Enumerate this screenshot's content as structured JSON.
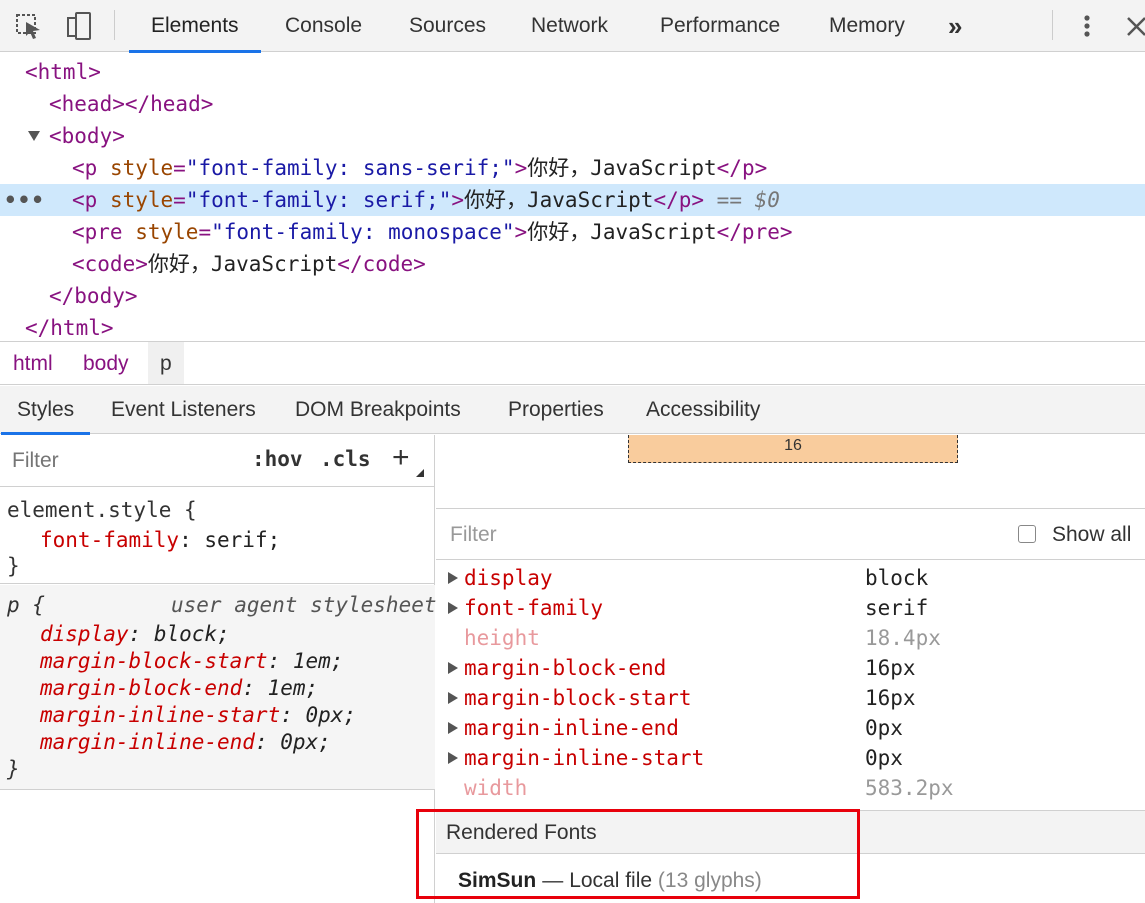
{
  "toolbar": {
    "tabs": [
      "Elements",
      "Console",
      "Sources",
      "Network",
      "Performance",
      "Memory"
    ],
    "more": "»",
    "icons": [
      "inspect-icon",
      "device-toggle-icon",
      "kebab-menu-icon",
      "close-icon"
    ]
  },
  "dom": {
    "lines": [
      {
        "tag_open": "<html>"
      },
      {
        "tag_open": "<head>",
        "tag_close": "</head>"
      },
      {
        "tag_open": "<body>"
      },
      {
        "tag_pre": "<p",
        "attr": "style",
        "value": "\"font-family: sans-serif;\"",
        "text": "你好，JavaScript",
        "tag_close": "</p>"
      },
      {
        "tag_pre": "<p",
        "attr": "style",
        "value": "\"font-family: serif;\"",
        "text": "你好，JavaScript",
        "tag_close": "</p>",
        "eq": "== $0"
      },
      {
        "tag_pre": "<pre",
        "attr": "style",
        "value": "\"font-family: monospace\"",
        "text": "你好，JavaScript",
        "tag_close": "</pre>"
      },
      {
        "tag_open": "<code>",
        "text": "你好，JavaScript",
        "tag_close": "</code>"
      },
      {
        "tag_close": "</body>"
      },
      {
        "tag_close": "</html>"
      }
    ],
    "dots": "•••"
  },
  "breadcrumbs": [
    "html",
    "body",
    "p"
  ],
  "subtabs": [
    "Styles",
    "Event Listeners",
    "DOM Breakpoints",
    "Properties",
    "Accessibility"
  ],
  "styles": {
    "filter_placeholder": "Filter",
    "hov": ":hov",
    "cls": ".cls",
    "plus": "+",
    "element_style": {
      "selector": "element.style {",
      "decl_prop": "font-family",
      "decl_val": "serif;",
      "close": "}"
    },
    "ua_rule": {
      "selector": "p {",
      "source": "user agent stylesheet",
      "decls": [
        {
          "prop": "display",
          "val": "block;"
        },
        {
          "prop": "margin-block-start",
          "val": "1em;"
        },
        {
          "prop": "margin-block-end",
          "val": "1em;"
        },
        {
          "prop": "margin-inline-start",
          "val": "0px;"
        },
        {
          "prop": "margin-inline-end",
          "val": "0px;"
        }
      ],
      "close": "}"
    }
  },
  "computed": {
    "box_margin": "16",
    "filter_placeholder": "Filter",
    "show_all": "Show all",
    "rows": [
      {
        "name": "display",
        "value": "block",
        "expandable": true
      },
      {
        "name": "font-family",
        "value": "serif",
        "expandable": true
      },
      {
        "name": "height",
        "value": "18.4px",
        "expandable": false
      },
      {
        "name": "margin-block-end",
        "value": "16px",
        "expandable": true
      },
      {
        "name": "margin-block-start",
        "value": "16px",
        "expandable": true
      },
      {
        "name": "margin-inline-end",
        "value": "0px",
        "expandable": true
      },
      {
        "name": "margin-inline-start",
        "value": "0px",
        "expandable": true
      },
      {
        "name": "width",
        "value": "583.2px",
        "expandable": false
      }
    ],
    "rendered_fonts": {
      "title": "Rendered Fonts",
      "name": "SimSun",
      "sep": "—",
      "source": "Local file",
      "count": "(13 glyphs)"
    }
  },
  "colors": {
    "accent": "#1a73e8",
    "highlight_box": "#e8000b",
    "selected_row": "#cfe8fc",
    "margin_box": "#f9cc9d"
  }
}
